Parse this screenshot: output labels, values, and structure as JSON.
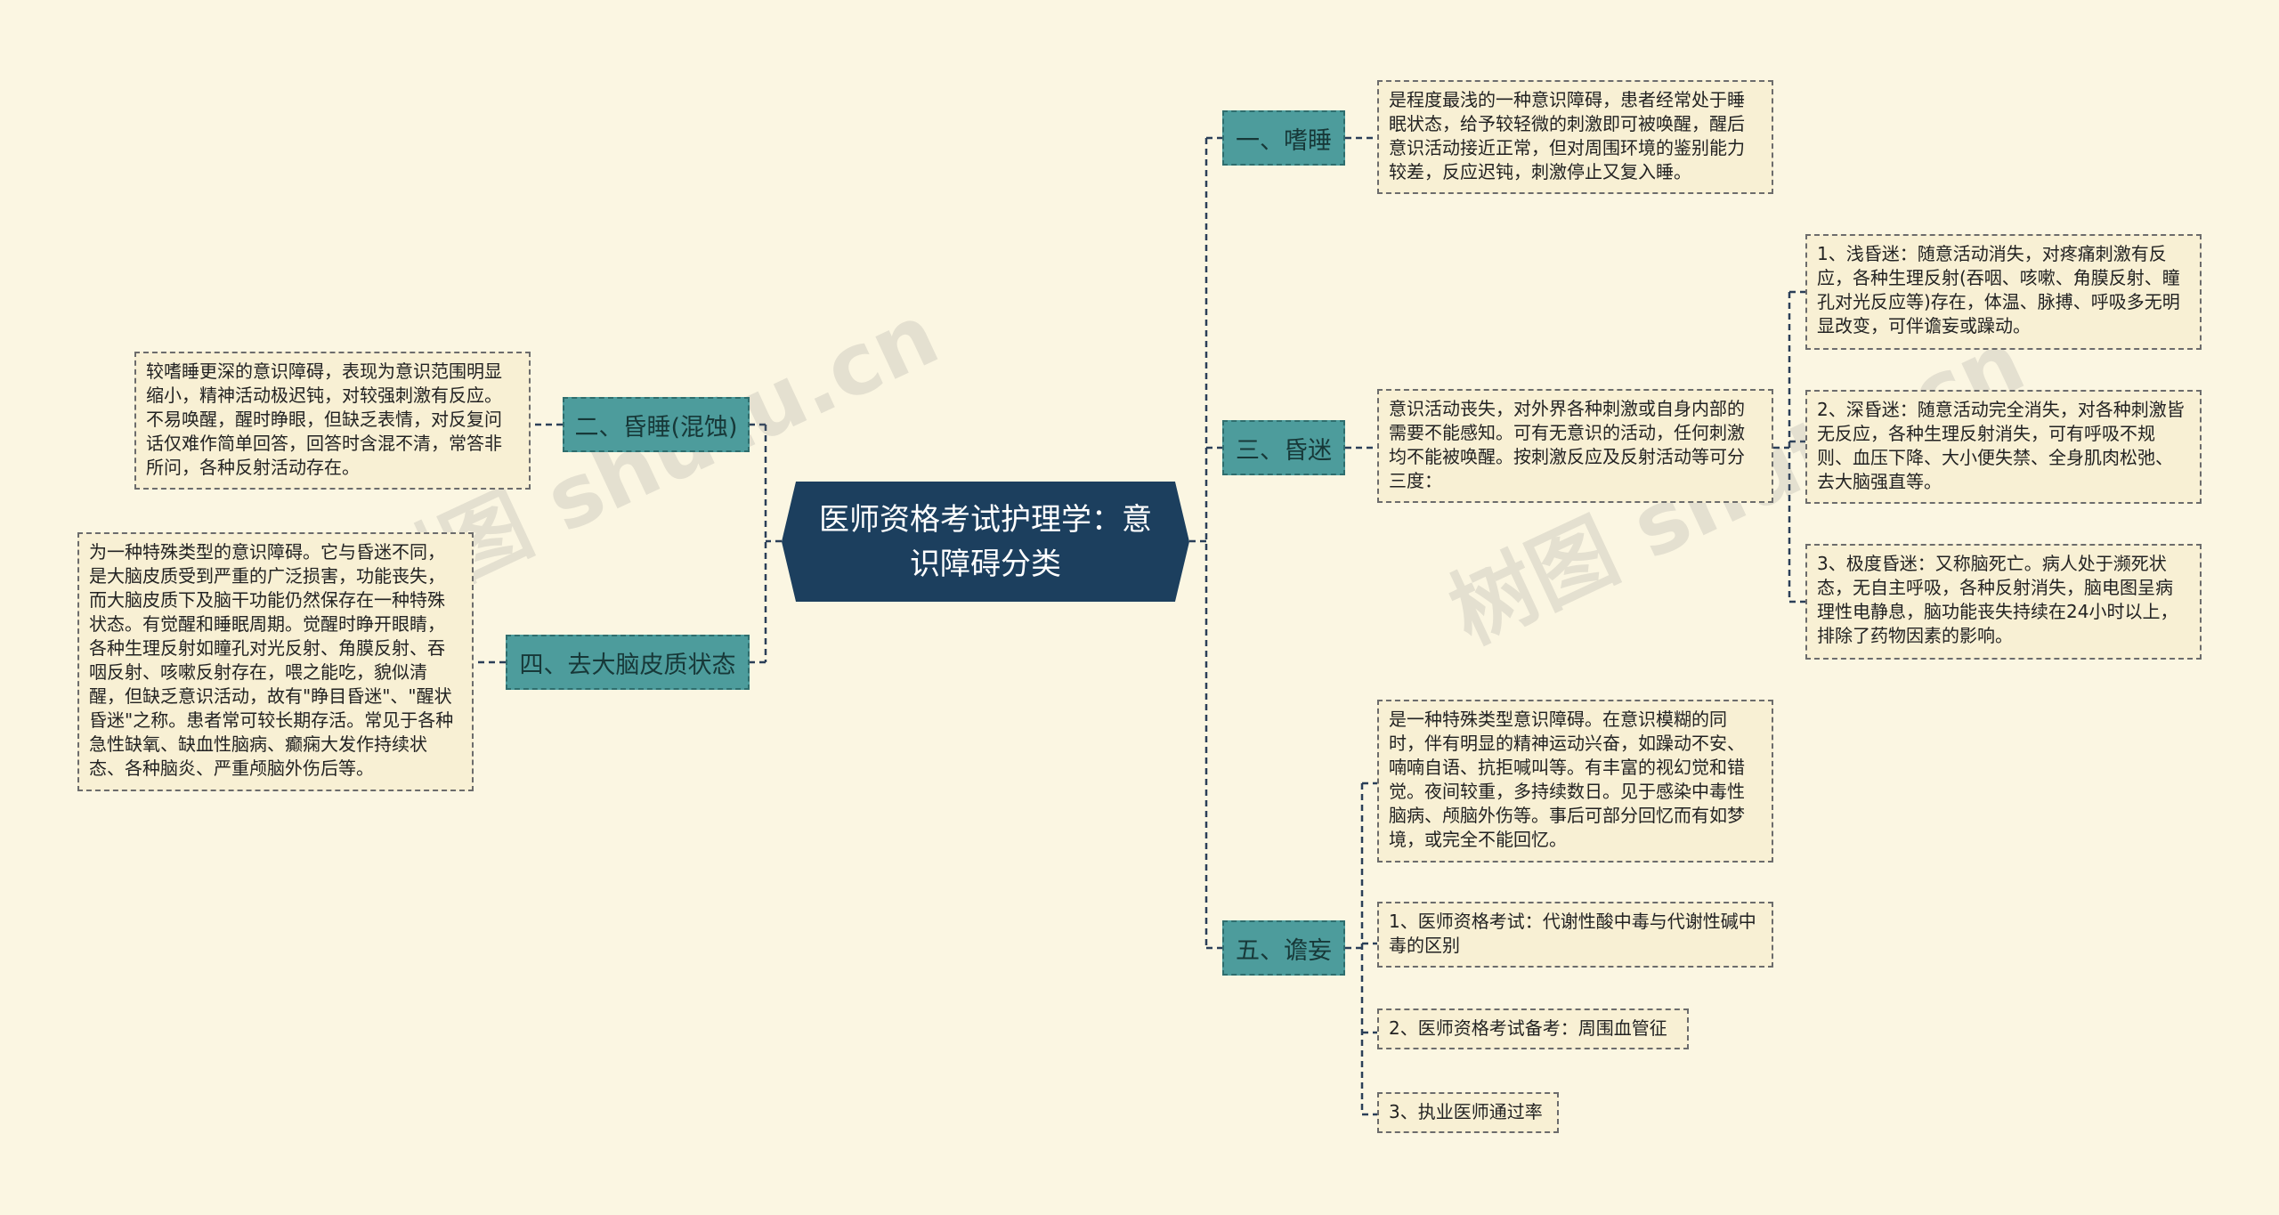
{
  "central": "医师资格考试护理学：意识障碍分类",
  "branches": [
    {
      "label": "一、嗜睡"
    },
    {
      "label": "二、昏睡(混蚀)"
    },
    {
      "label": "三、昏迷"
    },
    {
      "label": "四、去大脑皮质状态"
    },
    {
      "label": "五、谵妄"
    }
  ],
  "leaves": {
    "b1": "是程度最浅的一种意识障碍，患者经常处于睡眠状态，给予较轻微的刺激即可被唤醒，醒后意识活动接近正常，但对周围环境的鉴别能力较差，反应迟钝，刺激停止又复入睡。",
    "b2": "较嗜睡更深的意识障碍，表现为意识范围明显缩小，精神活动极迟钝，对较强刺激有反应。不易唤醒，醒时睁眼，但缺乏表情，对反复问话仅难作简单回答，回答时含混不清，常答非所问，各种反射活动存在。",
    "b3": "意识活动丧失，对外界各种刺激或自身内部的需要不能感知。可有无意识的活动，任何刺激均不能被唤醒。按刺激反应及反射活动等可分三度：",
    "b3_1": "1、浅昏迷：随意活动消失，对疼痛刺激有反应，各种生理反射(吞咽、咳嗽、角膜反射、瞳孔对光反应等)存在，体温、脉搏、呼吸多无明显改变，可伴谵妄或躁动。",
    "b3_2": "2、深昏迷：随意活动完全消失，对各种刺激皆无反应，各种生理反射消失，可有呼吸不规则、血压下降、大小便失禁、全身肌肉松弛、去大脑强直等。",
    "b3_3": "3、极度昏迷：又称脑死亡。病人处于濒死状态，无自主呼吸，各种反射消失，脑电图呈病理性电静息，脑功能丧失持续在24小时以上，排除了药物因素的影响。",
    "b4": "为一种特殊类型的意识障碍。它与昏迷不同，是大脑皮质受到严重的广泛损害，功能丧失，而大脑皮质下及脑干功能仍然保存在一种特殊状态。有觉醒和睡眠周期。觉醒时睁开眼睛，各种生理反射如瞳孔对光反射、角膜反射、吞咽反射、咳嗽反射存在，喂之能吃，貌似清醒，但缺乏意识活动，故有\"睁目昏迷\"、\"醒状昏迷\"之称。患者常可较长期存活。常见于各种急性缺氧、缺血性脑病、癫痫大发作持续状态、各种脑炎、严重颅脑外伤后等。",
    "b5": "是一种特殊类型意识障碍。在意识模糊的同时，伴有明显的精神运动兴奋，如躁动不安、喃喃自语、抗拒喊叫等。有丰富的视幻觉和错觉。夜间较重，多持续数日。见于感染中毒性脑病、颅脑外伤等。事后可部分回忆而有如梦境，或完全不能回忆。",
    "b5_1": "1、医师资格考试：代谢性酸中毒与代谢性碱中毒的区别",
    "b5_2": "2、医师资格考试备考：周围血管征",
    "b5_3": "3、执业医师通过率"
  },
  "watermarks": [
    "树图 shutu.cn",
    "树图 shutu.cn"
  ],
  "colors": {
    "background": "#fbf6e2",
    "central": "#1c3f5e",
    "branch": "#4d9c9c",
    "leaf": "#f8f0d4",
    "line": "#2b3f58"
  }
}
